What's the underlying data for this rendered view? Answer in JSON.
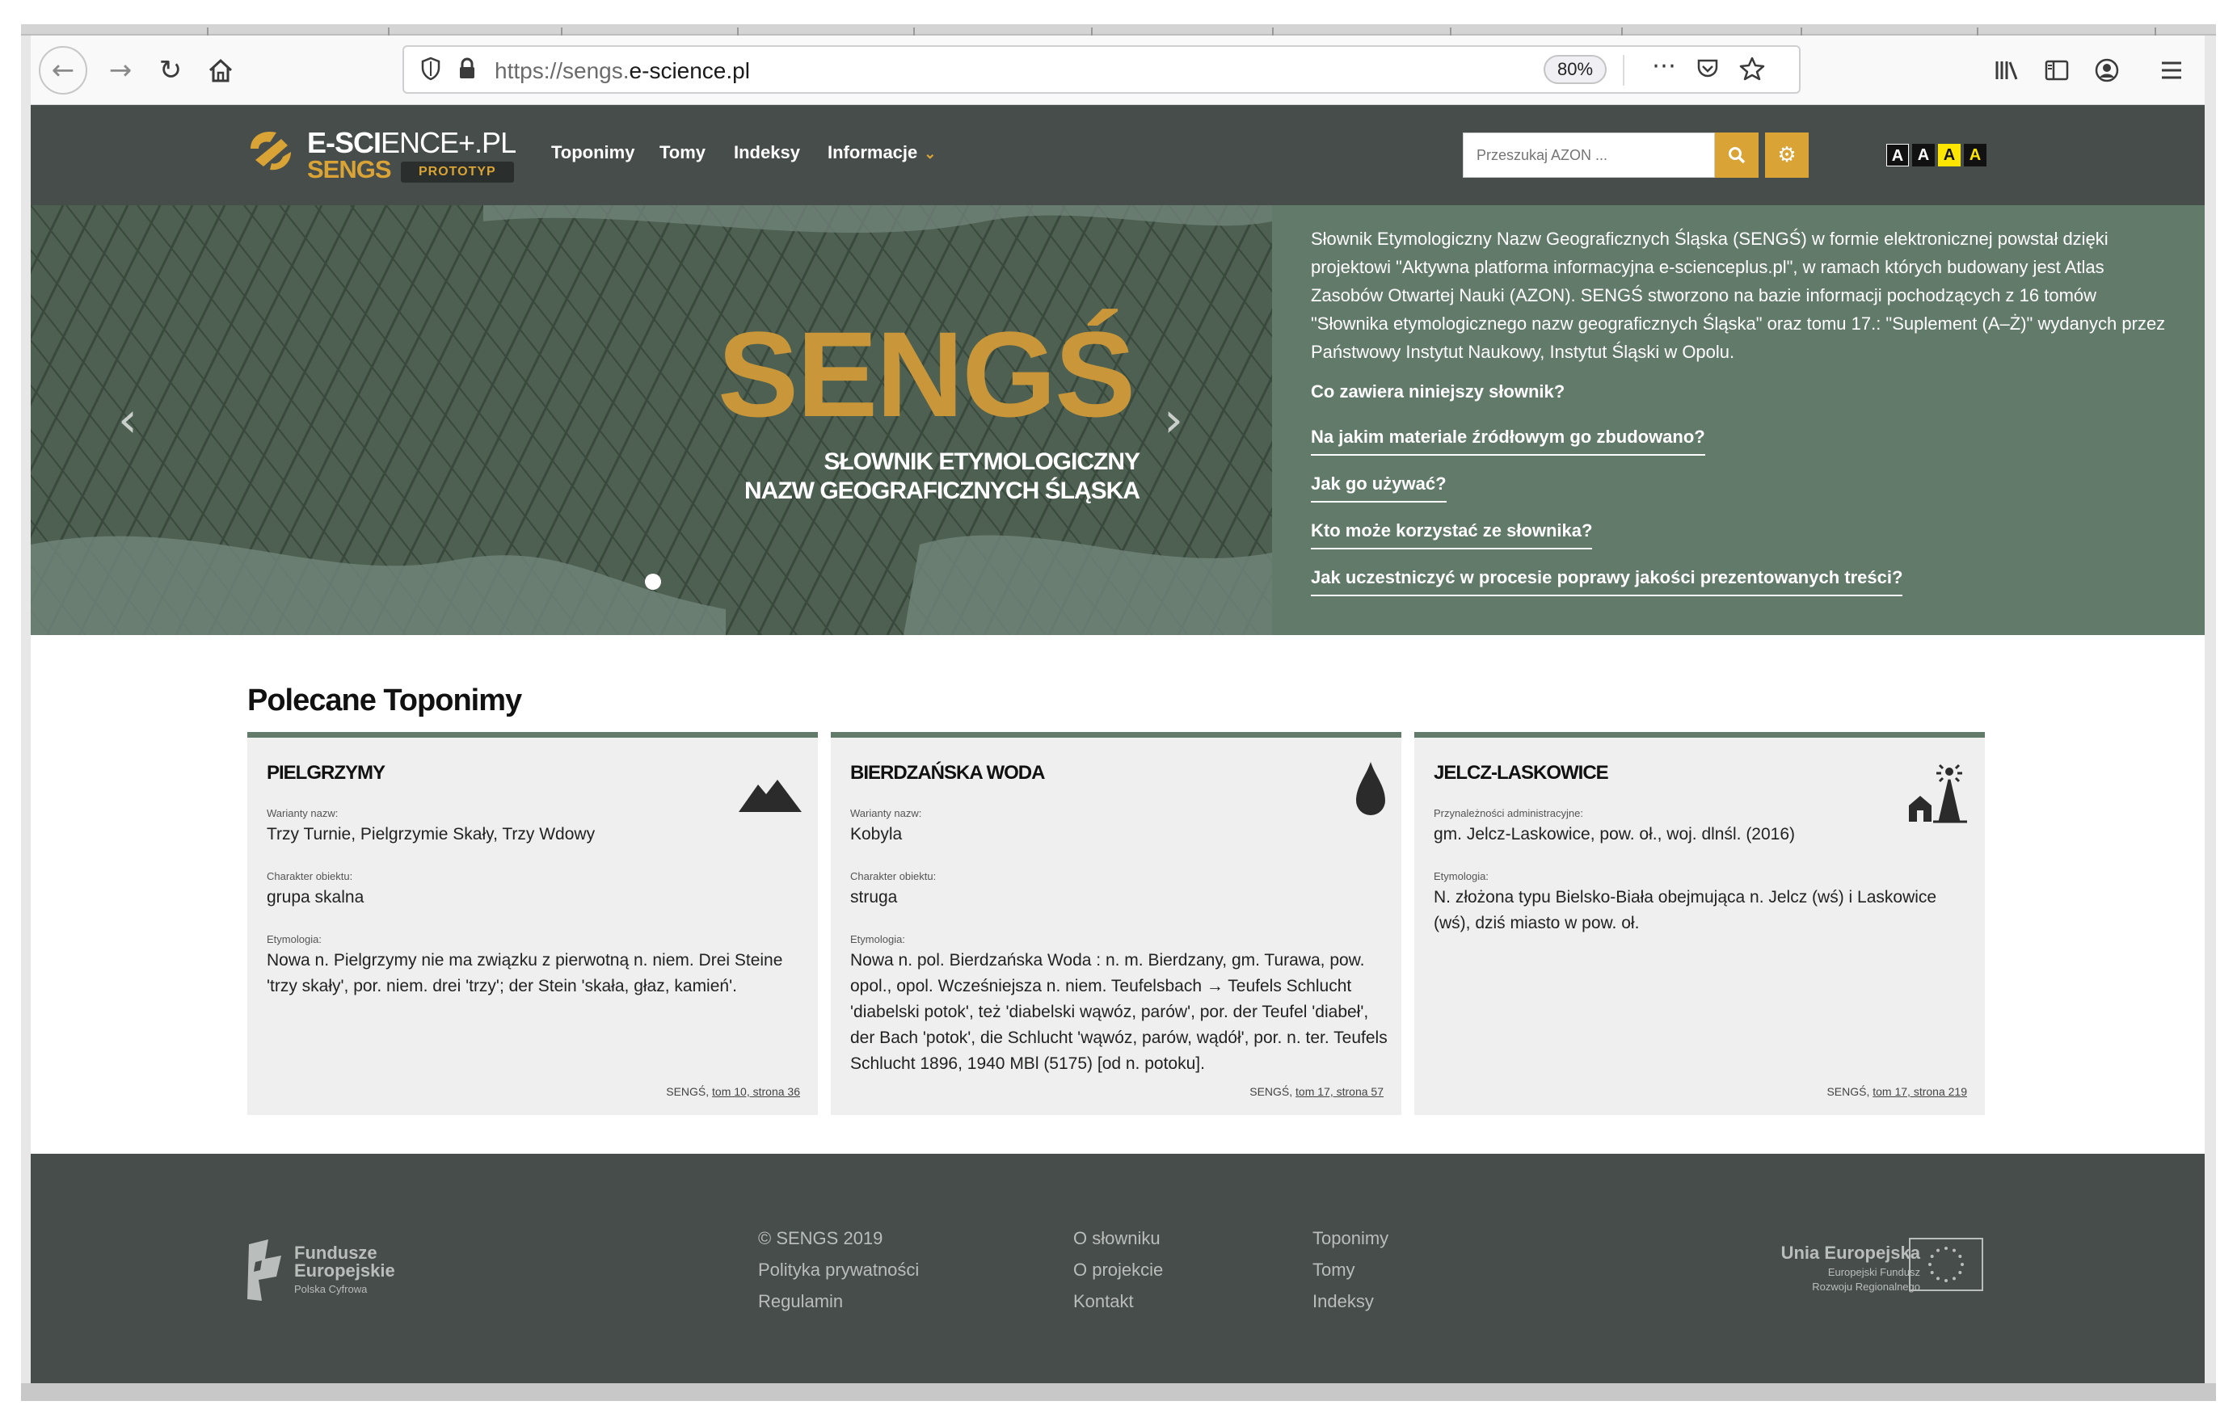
{
  "browser": {
    "url_prefix": "https://sengs.",
    "url_domain": "e-science.pl",
    "zoom": "80%",
    "icons": [
      "back-icon",
      "forward-icon",
      "reload-icon",
      "home-icon",
      "shield-icon",
      "lock-icon",
      "more-icon",
      "pocket-icon",
      "star-icon",
      "library-icon",
      "sidebar-icon",
      "account-icon",
      "menu-icon"
    ]
  },
  "header": {
    "logo_main_bold": "E-SCI",
    "logo_main_rest": "ENCE+.PL",
    "logo_sub": "SENGS",
    "logo_badge": "PROTOTYP",
    "nav": [
      "Toponimy",
      "Tomy",
      "Indeksy",
      "Informacje"
    ],
    "search_placeholder": "Przeszukaj AZON ...",
    "font_sizes": [
      "A",
      "A",
      "A",
      "A"
    ],
    "accent": "#d9a336"
  },
  "hero": {
    "title": "SENGŚ",
    "subtitle_line1": "SŁOWNIK ETYMOLOGICZNY",
    "subtitle_line2": "NAZW GEOGRAFICZNYCH ŚLĄSKA",
    "description": "Słownik Etymologiczny Nazw Geograficznych Śląska (SENGŚ) w formie elektronicznej powstał dzięki projektowi \"Aktywna platforma informacyjna e-scienceplus.pl\", w ramach których budowany jest Atlas Zasobów Otwartej Nauki (AZON). SENGŚ stworzono na bazie informacji pochodzących z 16 tomów \"Słownika etymologicznego nazw geograficznych Śląska\" oraz tomu 17.: \"Suplement (A–Ż)\" wydanych przez Państwowy Instytut Naukowy, Instytut Śląski w Opolu.",
    "links": [
      "Co zawiera niniejszy słownik?",
      "Na jakim materiale źródłowym go zbudowano?",
      "Jak go używać?",
      "Kto może korzystać ze słownika?",
      "Jak uczestniczyć w procesie poprawy jakości prezentowanych treści?"
    ]
  },
  "section": {
    "title": "Polecane Toponimy"
  },
  "cards": [
    {
      "title": "PIELGRZYMY",
      "icon": "mountain-icon",
      "label1": "Warianty nazw:",
      "value1": "Trzy Turnie, Pielgrzymie Skały, Trzy Wdowy",
      "label2": "Charakter obiektu:",
      "value2": "grupa skalna",
      "label3": "Etymologia:",
      "value3": "Nowa n. Pielgrzymy nie ma związku z pierwotną n. niem. Drei Steine 'trzy skały', por. niem. drei 'trzy'; der Stein 'skała, głaz, kamień'.",
      "src_prefix": "SENGŚ, ",
      "src_link": "tom 10, strona 36"
    },
    {
      "title": "BIERDZAŃSKA WODA",
      "icon": "water-drop-icon",
      "label1": "Warianty nazw:",
      "value1": "Kobyla",
      "label2": "Charakter obiektu:",
      "value2": "struga",
      "label3": "Etymologia:",
      "value3": "Nowa n. pol. Bierdzańska Woda : n. m. Bierdzany, gm. Turawa, pow. opol., opol. Wcześniejsza n. niem. Teufelsbach → Teufels Schlucht 'diabelski potok', też 'diabelski wąwóz, parów', por. der Teufel 'diabeł', der Bach 'potok', die Schlucht 'wąwóz, parów, wądół', por. n. ter. Teufels Schlucht 1896, 1940 MBl (5175) [od n. potoku].",
      "src_prefix": "SENGŚ, ",
      "src_link": "tom 17, strona 57"
    },
    {
      "title": "JELCZ-LASKOWICE",
      "icon": "town-icon",
      "label1": "Przynależności administracyjne:",
      "value1": "gm. Jelcz-Laskowice, pow. oł., woj. dlnśl. (2016)",
      "label2": "Etymologia:",
      "value2": "N. złożona typu Bielsko-Biała obejmująca n. Jelcz (wś) i Laskowice (wś), dziś miasto w pow. oł.",
      "src_prefix": "SENGŚ, ",
      "src_link": "tom 17, strona 219"
    }
  ],
  "footer": {
    "ff_line1": "Fundusze",
    "ff_line2": "Europejskie",
    "ff_small": "Polska Cyfrowa",
    "col1": [
      "© SENGS 2019",
      "Polityka prywatności",
      "Regulamin"
    ],
    "col2": [
      "O słowniku",
      "O projekcie",
      "Kontakt"
    ],
    "col3": [
      "Toponimy",
      "Tomy",
      "Indeksy"
    ],
    "eu_title": "Unia Europejska",
    "eu_line1": "Europejski Fundusz",
    "eu_line2": "Rozwoju Regionalnego"
  }
}
